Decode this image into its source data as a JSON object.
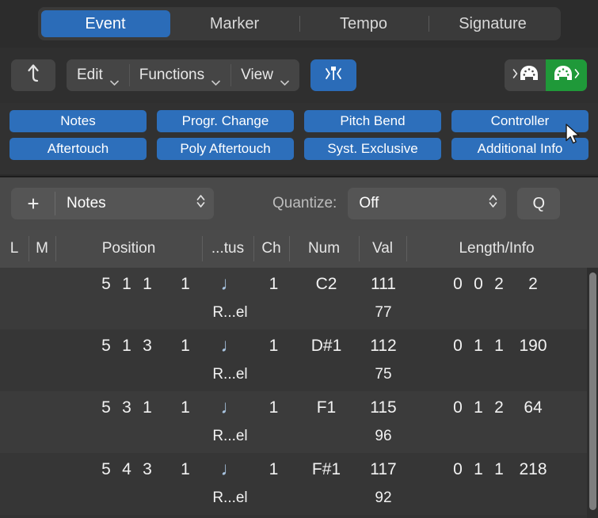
{
  "tabs": [
    {
      "label": "Event",
      "active": true
    },
    {
      "label": "Marker",
      "active": false
    },
    {
      "label": "Tempo",
      "active": false
    },
    {
      "label": "Signature",
      "active": false
    }
  ],
  "toolbar": {
    "up_level_icon": "up-arrow-icon",
    "menus": [
      {
        "label": "Edit",
        "icon": "chevron-down-icon"
      },
      {
        "label": "Functions",
        "icon": "chevron-down-icon"
      },
      {
        "label": "View",
        "icon": "chevron-down-icon"
      }
    ],
    "catch_playhead_icon": "catch-playhead-icon",
    "midi_in_icon": "midi-in-icon",
    "midi_out_icon": "midi-out-icon",
    "midi_out_active": true
  },
  "filters": {
    "row1": [
      "Notes",
      "Progr. Change",
      "Pitch Bend",
      "Controller"
    ],
    "row2": [
      "Aftertouch",
      "Poly Aftertouch",
      "Syst. Exclusive",
      "Additional Info"
    ]
  },
  "controls": {
    "add_label": "+",
    "event_type": "Notes",
    "quantize_label": "Quantize:",
    "quantize_value": "Off",
    "q_button": "Q",
    "stepper_icon": "up-down-chevron-icon"
  },
  "columns": [
    {
      "key": "L",
      "label": "L"
    },
    {
      "key": "M",
      "label": "M"
    },
    {
      "key": "Position",
      "label": "Position"
    },
    {
      "key": "Status",
      "label": "...tus"
    },
    {
      "key": "Ch",
      "label": "Ch"
    },
    {
      "key": "Num",
      "label": "Num"
    },
    {
      "key": "Val",
      "label": "Val"
    },
    {
      "key": "LengthInfo",
      "label": "Length/Info"
    }
  ],
  "rows": [
    {
      "bar": "5",
      "beat": "1",
      "div": "1",
      "tick": "1",
      "status_glyph": "♩",
      "status_sub": "R...el",
      "ch": "1",
      "num": "C2",
      "val": "111",
      "val_sub": "77",
      "len_bar": "0",
      "len_beat": "0",
      "len_div": "2",
      "len_tick": "2"
    },
    {
      "bar": "5",
      "beat": "1",
      "div": "3",
      "tick": "1",
      "status_glyph": "♩",
      "status_sub": "R...el",
      "ch": "1",
      "num": "D#1",
      "val": "112",
      "val_sub": "75",
      "len_bar": "0",
      "len_beat": "1",
      "len_div": "1",
      "len_tick": "190"
    },
    {
      "bar": "5",
      "beat": "3",
      "div": "1",
      "tick": "1",
      "status_glyph": "♩",
      "status_sub": "R...el",
      "ch": "1",
      "num": "F1",
      "val": "115",
      "val_sub": "96",
      "len_bar": "0",
      "len_beat": "1",
      "len_div": "2",
      "len_tick": "64"
    },
    {
      "bar": "5",
      "beat": "4",
      "div": "3",
      "tick": "1",
      "status_glyph": "♩",
      "status_sub": "R...el",
      "ch": "1",
      "num": "F#1",
      "val": "117",
      "val_sub": "92",
      "len_bar": "0",
      "len_beat": "1",
      "len_div": "1",
      "len_tick": "218"
    }
  ],
  "colors": {
    "accent_blue": "#2b6cb8",
    "filter_blue": "#2d6fbb",
    "midi_green": "#1f9939",
    "note_glyph": "#a8c4e0",
    "window_bg": "#2b2b2b"
  },
  "cursor": {
    "icon": "mouse-pointer-icon"
  }
}
